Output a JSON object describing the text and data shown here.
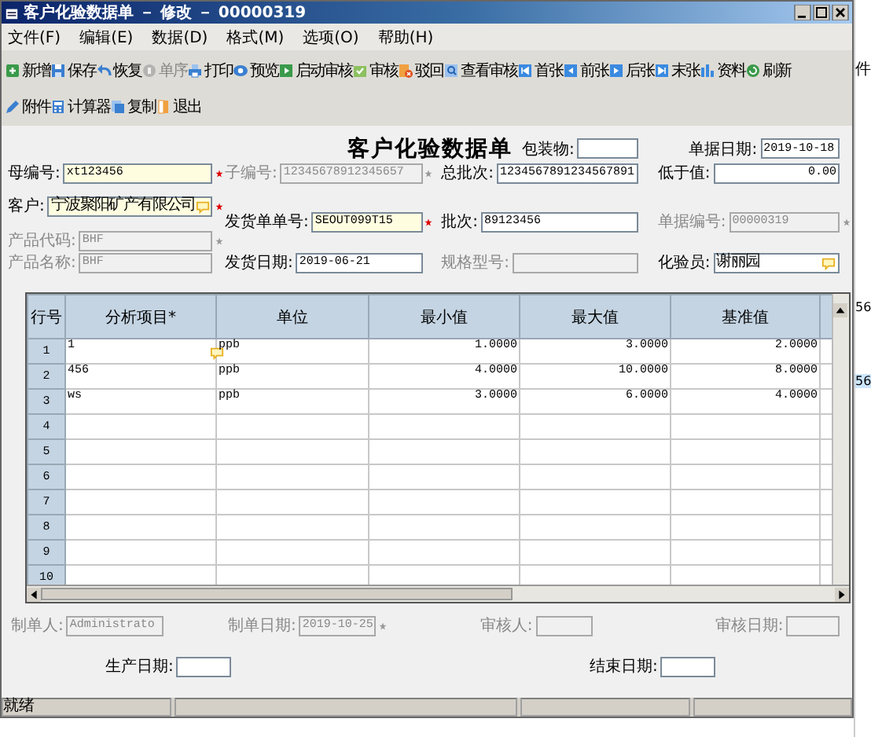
{
  "window": {
    "title": "客户化验数据单 － 修改 － 00000319"
  },
  "menu": [
    "文件(F)",
    "编辑(E)",
    "数据(D)",
    "格式(M)",
    "选项(O)",
    "帮助(H)"
  ],
  "toolbars": [
    [
      {
        "label": "新增",
        "disabled": false
      },
      {
        "label": "保存",
        "disabled": false
      },
      {
        "label": "恢复",
        "disabled": false
      },
      {
        "label": "单序",
        "disabled": true
      },
      {
        "label": "打印",
        "disabled": false
      },
      {
        "label": "预览",
        "disabled": false
      },
      {
        "label": "启动审核",
        "disabled": false
      },
      {
        "label": "审核",
        "disabled": false
      },
      {
        "label": "驳回",
        "disabled": false
      },
      {
        "label": "查看审核",
        "disabled": false
      },
      {
        "label": "首张",
        "disabled": false
      },
      {
        "label": "前张",
        "disabled": false
      },
      {
        "label": "后张",
        "disabled": false
      },
      {
        "label": "末张",
        "disabled": false
      },
      {
        "label": "资料",
        "disabled": false
      },
      {
        "label": "刷新",
        "disabled": false
      }
    ],
    [
      {
        "label": "附件",
        "disabled": false
      },
      {
        "label": "计算器",
        "disabled": false
      },
      {
        "label": "复制",
        "disabled": false
      },
      {
        "label": "退出",
        "disabled": false
      }
    ]
  ],
  "form": {
    "title": "客户化验数据单",
    "top_fields": [
      {
        "label": "包装物:",
        "required": false,
        "disabled": false,
        "lookup": false
      },
      {
        "label": "单据日期:",
        "value": "2019-10-18",
        "required": false,
        "disabled": false,
        "lookup": false
      }
    ],
    "columns": [
      [
        {
          "label": "母编号:",
          "value": "xt123456",
          "required": true,
          "disabled": false,
          "lookup": false
        },
        {
          "label": "客户:",
          "value": "宁波聚阳矿产有限公司",
          "required": true,
          "disabled": false,
          "lookup": true
        },
        {
          "label": "产品代码:",
          "value": "BHF",
          "required": true,
          "disabled": true,
          "lookup": false
        },
        {
          "label": "产品名称:",
          "value": "BHF",
          "required": false,
          "disabled": true,
          "lookup": false
        }
      ],
      [
        {
          "label": "子编号:",
          "value": "12345678912345657",
          "required": true,
          "disabled": true,
          "lookup": false
        },
        {
          "label": "发货单单号:",
          "value": "SEOUT099T15",
          "required": true,
          "disabled": false,
          "lookup": false
        },
        {
          "label": "发货日期:",
          "value": "2019-06-21",
          "required": false,
          "disabled": false,
          "lookup": false
        }
      ],
      [
        {
          "label": "总批次:",
          "value": "1234567891234567891",
          "required": false,
          "disabled": false,
          "lookup": false
        },
        {
          "label": "批次:",
          "value": "89123456",
          "required": false,
          "disabled": false,
          "lookup": false
        },
        {
          "label": "规格型号:",
          "required": false,
          "disabled": true,
          "lookup": false
        }
      ],
      [
        {
          "label": "低于值:",
          "value": "0.00",
          "required": false,
          "disabled": false,
          "lookup": false,
          "numeric": true
        },
        {
          "label": "单据编号:",
          "value": "00000319",
          "required": true,
          "disabled": true,
          "lookup": false
        },
        {
          "label": "化验员:",
          "value": "谢丽园",
          "required": false,
          "disabled": false,
          "lookup": true
        }
      ]
    ]
  },
  "table": {
    "columns": [
      "行号",
      "分析项目*",
      "单位",
      "最小值",
      "最大值",
      "基准值"
    ],
    "rows": [
      {
        "number": "1",
        "lookup": true,
        "cells": [
          "1",
          "ppb",
          "1.0000",
          "3.0000",
          "2.0000"
        ]
      },
      {
        "number": "2",
        "lookup": false,
        "cells": [
          "456",
          "ppb",
          "4.0000",
          "10.0000",
          "8.0000"
        ]
      },
      {
        "number": "3",
        "lookup": false,
        "cells": [
          "ws",
          "ppb",
          "3.0000",
          "6.0000",
          "4.0000"
        ]
      },
      {
        "number": "4",
        "lookup": false
      },
      {
        "number": "5",
        "lookup": false
      },
      {
        "number": "6",
        "lookup": false
      },
      {
        "number": "7",
        "lookup": false
      },
      {
        "number": "8",
        "lookup": false
      },
      {
        "number": "9",
        "lookup": false
      },
      {
        "number": "10",
        "lookup": false
      }
    ]
  },
  "footer": {
    "rows": [
      [
        {
          "label": "制单人:",
          "value": "Administrato",
          "required": false,
          "disabled": true,
          "lookup": false
        },
        {
          "label": "制单日期:",
          "value": "2019-10-25",
          "required": true,
          "disabled": true,
          "lookup": false
        },
        {
          "label": "审核人:",
          "required": false,
          "disabled": true,
          "lookup": false
        },
        {
          "label": "审核日期:",
          "required": false,
          "disabled": true,
          "lookup": false
        }
      ],
      [
        {
          "label": "生产日期:",
          "required": false,
          "disabled": false,
          "lookup": false
        },
        {
          "label": "结束日期:",
          "required": false,
          "disabled": false,
          "lookup": false
        }
      ]
    ]
  },
  "status_bar": [
    "就绪"
  ],
  "background_window": [
    {
      "text": "件",
      "selected": false
    },
    {
      "text": "56",
      "selected": false
    },
    {
      "text": "56",
      "selected": true
    }
  ]
}
